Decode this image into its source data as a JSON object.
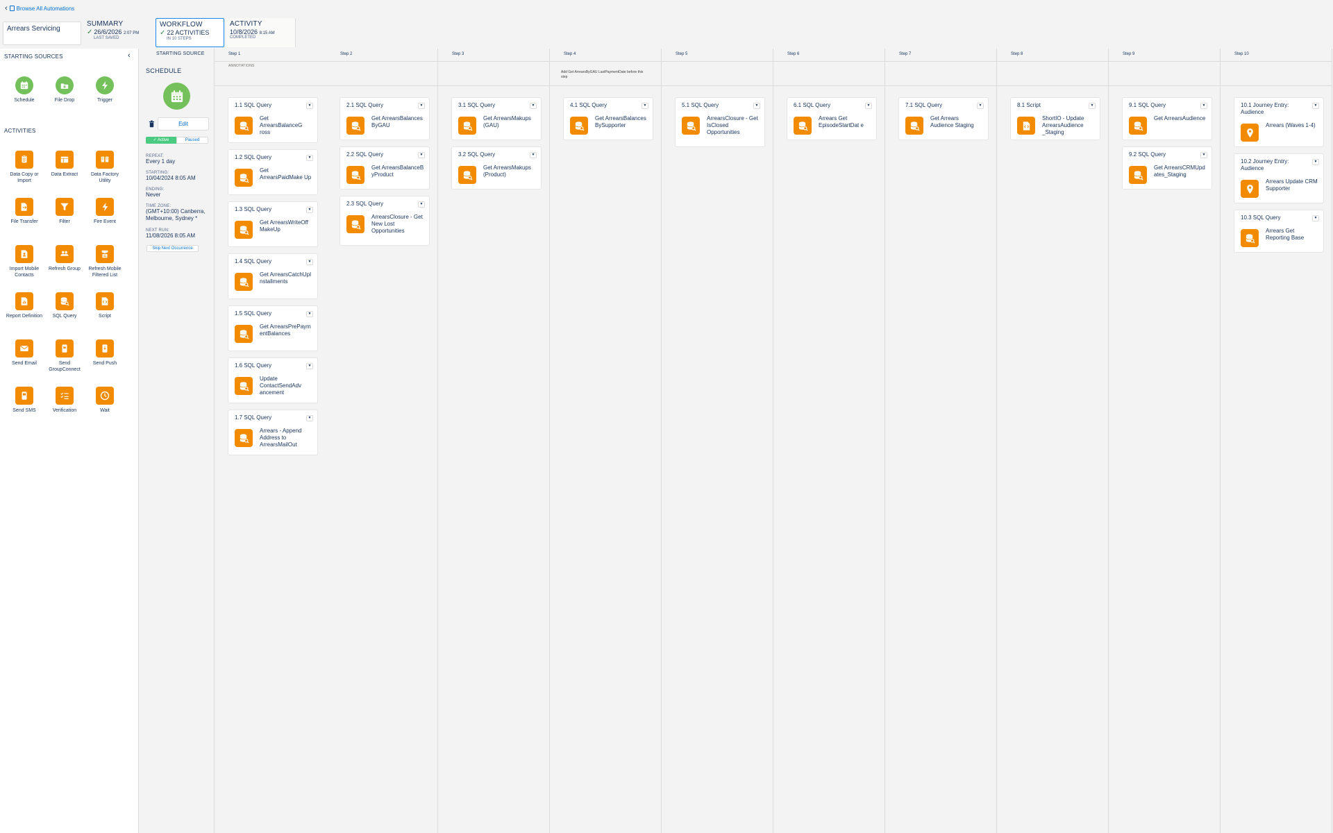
{
  "header": {
    "back_label": "Browse All Automations",
    "automation_name": "Arrears Servicing",
    "summary": {
      "label": "SUMMARY",
      "date": "26/6/2026",
      "time": "2:07 PM",
      "sub": "LAST SAVED"
    },
    "workflow": {
      "label": "WORKFLOW",
      "value": "22 ACTIVITIES",
      "sub": "IN 10 STEPS"
    },
    "activity": {
      "label": "ACTIVITY",
      "date": "10/8/2026",
      "time": "8:15 AM",
      "sub": "COMPLETED"
    }
  },
  "palette": {
    "sources_title": "STARTING SOURCES",
    "activities_title": "ACTIVITIES",
    "sources": [
      {
        "label": "Schedule",
        "icon": "calendar-icon"
      },
      {
        "label": "File Drop",
        "icon": "file-drop-icon"
      },
      {
        "label": "Trigger",
        "icon": "lightning-icon"
      }
    ],
    "activities": [
      {
        "label": "Data Copy or Import",
        "icon": "data-copy-icon"
      },
      {
        "label": "Data Extract",
        "icon": "data-extract-icon"
      },
      {
        "label": "Data Factory Utility",
        "icon": "data-factory-icon"
      },
      {
        "label": "File Transfer",
        "icon": "file-transfer-icon"
      },
      {
        "label": "Filter",
        "icon": "filter-icon"
      },
      {
        "label": "Fire Event",
        "icon": "fire-event-icon"
      },
      {
        "label": "Import Mobile Contacts",
        "icon": "import-contacts-icon"
      },
      {
        "label": "Refresh Group",
        "icon": "refresh-group-icon"
      },
      {
        "label": "Refresh Mobile Filtered List",
        "icon": "refresh-list-icon"
      },
      {
        "label": "Report Definition",
        "icon": "report-icon"
      },
      {
        "label": "SQL Query",
        "icon": "sql-query-icon"
      },
      {
        "label": "Script",
        "icon": "script-icon"
      },
      {
        "label": "Send Email",
        "icon": "email-icon"
      },
      {
        "label": "Send GroupConnect",
        "icon": "groupconnect-icon"
      },
      {
        "label": "Send Push",
        "icon": "push-icon"
      },
      {
        "label": "Send SMS",
        "icon": "sms-icon"
      },
      {
        "label": "Verification",
        "icon": "verification-icon"
      },
      {
        "label": "Wait",
        "icon": "clock-icon"
      }
    ]
  },
  "source": {
    "header": "STARTING SOURCE",
    "title": "SCHEDULE",
    "edit_label": "Edit",
    "active_label": "Active",
    "paused_label": "Paused",
    "fields": [
      {
        "key": "REPEAT:",
        "value": "Every 1 day"
      },
      {
        "key": "STARTING:",
        "value": "10/04/2024 8:05 AM"
      },
      {
        "key": "ENDING:",
        "value": "Never"
      },
      {
        "key": "TIME ZONE:",
        "value": "(GMT+10:00) Canberra, Melbourne, Sydney *"
      },
      {
        "key": "NEXT RUN:",
        "value": "11/08/2026 8:05 AM"
      }
    ],
    "skip_label": "Skip Next Occurrence"
  },
  "annotations_label": "ANNOTATIONS",
  "steps": [
    {
      "label": "Step 1",
      "annotation": "",
      "cards": [
        {
          "title": "1.1 SQL Query",
          "name": "Get ArrearsBalanceG ross",
          "icon": "sql-query-icon"
        },
        {
          "title": "1.2 SQL Query",
          "name": "Get ArrearsPaidMake Up",
          "icon": "sql-query-icon"
        },
        {
          "title": "1.3 SQL Query",
          "name": "Get ArrearsWriteOff MakeUp",
          "icon": "sql-query-icon"
        },
        {
          "title": "1.4 SQL Query",
          "name": "Get ArrearsCatchUpI nstallments",
          "icon": "sql-query-icon"
        },
        {
          "title": "1.5 SQL Query",
          "name": "Get ArrearsPrePaym entBalances",
          "icon": "sql-query-icon"
        },
        {
          "title": "1.6 SQL Query",
          "name": "Update ContactSendAdv ancement",
          "icon": "sql-query-icon"
        },
        {
          "title": "1.7 SQL Query",
          "name": "Arrears - Append Address to ArrearsMailOut",
          "icon": "sql-query-icon"
        }
      ]
    },
    {
      "label": "Step 2",
      "annotation": "",
      "cards": [
        {
          "title": "2.1 SQL Query",
          "name": "Get ArrearsBalances ByGAU",
          "icon": "sql-query-icon"
        },
        {
          "title": "2.2 SQL Query",
          "name": "Get ArrearsBalanceB yProduct",
          "icon": "sql-query-icon"
        },
        {
          "title": "2.3 SQL Query",
          "name": "ArrearsClosure - Get New Lost Opportunities",
          "icon": "sql-query-icon"
        }
      ]
    },
    {
      "label": "Step 3",
      "annotation": "",
      "cards": [
        {
          "title": "3.1 SQL Query",
          "name": "Get ArrearsMakups (GAU)",
          "icon": "sql-query-icon"
        },
        {
          "title": "3.2 SQL Query",
          "name": "Get ArrearsMakups (Product)",
          "icon": "sql-query-icon"
        }
      ]
    },
    {
      "label": "Step 4",
      "annotation": "Add Get ArrearsByGAU LastPaymentDate before this step",
      "cards": [
        {
          "title": "4.1 SQL Query",
          "name": "Get ArrearsBalances BySupporter",
          "icon": "sql-query-icon"
        }
      ]
    },
    {
      "label": "Step 5",
      "annotation": "",
      "cards": [
        {
          "title": "5.1 SQL Query",
          "name": "ArrearsClosure - Get IsClosed Opportunities",
          "icon": "sql-query-icon"
        }
      ]
    },
    {
      "label": "Step 6",
      "annotation": "",
      "cards": [
        {
          "title": "6.1 SQL Query",
          "name": "Arrears Get EpisodeStartDat e",
          "icon": "sql-query-icon"
        }
      ]
    },
    {
      "label": "Step 7",
      "annotation": "",
      "cards": [
        {
          "title": "7.1 SQL Query",
          "name": "Get Arrears Audience Staging",
          "icon": "sql-query-icon"
        }
      ]
    },
    {
      "label": "Step 8",
      "annotation": "",
      "cards": [
        {
          "title": "8.1 Script",
          "name": "ShortIO - Update ArrearsAudience _Staging",
          "icon": "script-icon"
        }
      ]
    },
    {
      "label": "Step 9",
      "annotation": "",
      "cards": [
        {
          "title": "9.1 SQL Query",
          "name": "Get ArrearsAudience",
          "icon": "sql-query-icon"
        },
        {
          "title": "9.2 SQL Query",
          "name": "Get ArrearsCRMUpd ates_Staging",
          "icon": "sql-query-icon"
        }
      ]
    },
    {
      "label": "Step 10",
      "annotation": "",
      "cards": [
        {
          "title": "10.1 Journey Entry: Audience",
          "name": "Arrears (Waves 1-4)",
          "icon": "journey-pin-icon"
        },
        {
          "title": "10.2 Journey Entry: Audience",
          "name": "Arrears Update CRM Supporter",
          "icon": "journey-pin-icon"
        },
        {
          "title": "10.3 SQL Query",
          "name": "Arrears Get Reporting Base",
          "icon": "sql-query-icon"
        }
      ]
    }
  ],
  "colors": {
    "accent": "#0070d2",
    "activity_orange": "#f28b00",
    "source_green": "#74c05a",
    "active_green": "#4bca81"
  }
}
